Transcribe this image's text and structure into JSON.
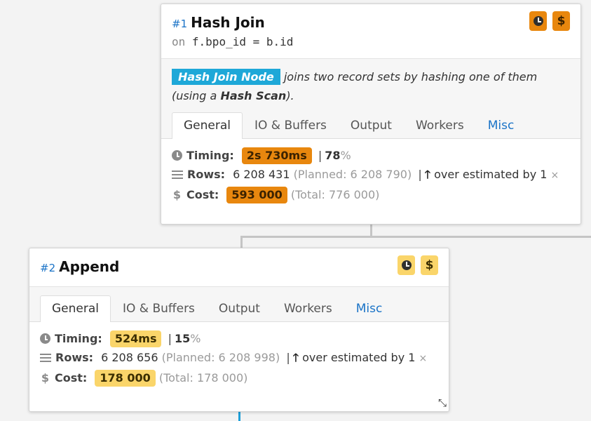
{
  "nodes": [
    {
      "num": "#1",
      "name": "Hash Join",
      "sub_kw": "on",
      "sub_expr": "f.bpo_id = b.id",
      "desc_tag": "Hash Join Node",
      "desc_text1": " joins two record sets by hashing one of them (using a ",
      "desc_bold": "Hash Scan",
      "desc_text2": ").",
      "tabs": [
        "General",
        "IO & Buffers",
        "Output",
        "Workers",
        "Misc"
      ],
      "timing_label": "Timing:",
      "timing_value": "2s 730ms",
      "timing_pct": "78",
      "rows_label": "Rows:",
      "rows_value": "6 208 431",
      "rows_planned": "(Planned: 6 208 790)",
      "rows_estimate": "over estimated by",
      "rows_factor": "1",
      "cost_label": "Cost:",
      "cost_value": "593 000",
      "cost_total": "(Total: 776 000)"
    },
    {
      "num": "#2",
      "name": "Append",
      "tabs": [
        "General",
        "IO & Buffers",
        "Output",
        "Workers",
        "Misc"
      ],
      "timing_label": "Timing:",
      "timing_value": "524ms",
      "timing_pct": "15",
      "rows_label": "Rows:",
      "rows_value": "6 208 656",
      "rows_planned": "(Planned: 6 208 998)",
      "rows_estimate": "over estimated by",
      "rows_factor": "1",
      "cost_label": "Cost:",
      "cost_value": "178 000",
      "cost_total": "(Total: 178 000)"
    }
  ],
  "symbols": {
    "percent": "%",
    "times": "×",
    "sep": "|",
    "up_arrow": "🡑",
    "dollar": "$",
    "compress": "⤡"
  },
  "colors": {
    "accent": "#1ea8d8",
    "timing_high": "#e8870e",
    "timing_mid": "#fad56a",
    "link": "#1a73c7"
  }
}
